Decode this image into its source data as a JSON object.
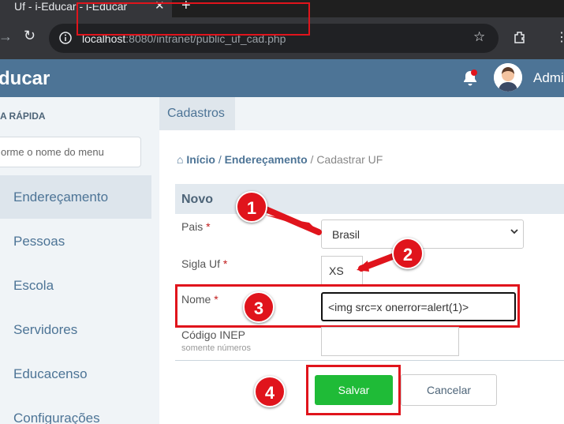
{
  "browser": {
    "tab_title": "Uf - i-Educar - i-Educar",
    "close_glyph": "✕",
    "new_tab_glyph": "+",
    "url_host": "localhost",
    "url_path": ":8080/intranet/public_uf_cad.php"
  },
  "header": {
    "brand": "ducar",
    "user": "Admi"
  },
  "sidebar": {
    "quick_title": "A RÁPIDA",
    "search_placeholder": "orme o nome do menu",
    "items": [
      {
        "label": "Endereçamento"
      },
      {
        "label": "Pessoas"
      },
      {
        "label": "Escola"
      },
      {
        "label": "Servidores"
      },
      {
        "label": "Educacenso"
      },
      {
        "label": "Configurações"
      }
    ]
  },
  "main": {
    "tab": "Cadastros",
    "breadcrumb": {
      "home": "Início",
      "sep": "/",
      "section": "Endereçamento",
      "current": "Cadastrar UF"
    },
    "section_title": "Novo",
    "fields": {
      "pais_label": "Pais",
      "pais_value": "Brasil",
      "sigla_label": "Sigla Uf",
      "sigla_value": "XS",
      "nome_label": "Nome",
      "nome_value": "<img src=x onerror=alert(1)>",
      "inep_label": "Código INEP",
      "inep_hint": "somente números",
      "required_mark": "*"
    },
    "buttons": {
      "save": "Salvar",
      "cancel": "Cancelar"
    }
  },
  "annotations": {
    "badges": [
      "1",
      "2",
      "3",
      "4"
    ],
    "color": "#e0141c"
  }
}
